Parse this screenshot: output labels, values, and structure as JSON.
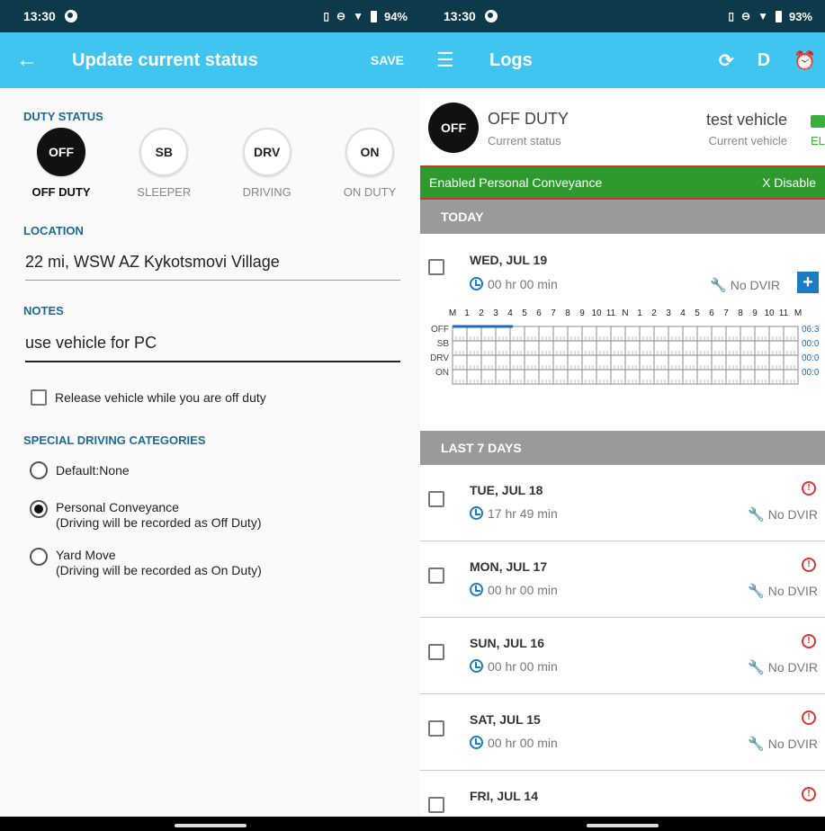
{
  "left": {
    "status_bar": {
      "time": "13:30",
      "battery": "94%"
    },
    "app_bar": {
      "title": "Update current status",
      "save": "SAVE"
    },
    "duty_status": {
      "label": "DUTY STATUS",
      "options": [
        {
          "code": "OFF",
          "label": "OFF DUTY",
          "active": true
        },
        {
          "code": "SB",
          "label": "SLEEPER",
          "active": false
        },
        {
          "code": "DRV",
          "label": "DRIVING",
          "active": false
        },
        {
          "code": "ON",
          "label": "ON DUTY",
          "active": false
        }
      ]
    },
    "location": {
      "label": "LOCATION",
      "value": "22 mi, WSW AZ Kykotsmovi Village"
    },
    "notes": {
      "label": "NOTES",
      "value": "use vehicle for PC"
    },
    "release_vehicle": {
      "label": "Release vehicle while you are off duty",
      "checked": false
    },
    "special_categories": {
      "label": "SPECIAL DRIVING CATEGORIES",
      "options": [
        {
          "label": "Default:None",
          "sublabel": "",
          "selected": false
        },
        {
          "label": "Personal Conveyance",
          "sublabel": "(Driving will be recorded as Off Duty)",
          "selected": true
        },
        {
          "label": "Yard Move",
          "sublabel": "(Driving will be recorded as On Duty)",
          "selected": false
        }
      ]
    }
  },
  "right": {
    "status_bar": {
      "time": "13:30",
      "battery": "93%"
    },
    "app_bar": {
      "title": "Logs",
      "d_label": "D"
    },
    "current": {
      "code": "OFF",
      "status": "OFF DUTY",
      "status_caption": "Current status",
      "vehicle": "test vehicle",
      "vehicle_caption": "Current vehicle",
      "eld": "ELD"
    },
    "banner": {
      "text": "Enabled Personal Conveyance",
      "action": "X Disable"
    },
    "today": {
      "header": "TODAY",
      "date": "WED, JUL 19",
      "duration": "00 hr  00 min",
      "dvir": "No DVIR",
      "plus": "+",
      "graph": {
        "hour_labels": [
          "M",
          "1",
          "2",
          "3",
          "4",
          "5",
          "6",
          "7",
          "8",
          "9",
          "10",
          "11",
          "N",
          "1",
          "2",
          "3",
          "4",
          "5",
          "6",
          "7",
          "8",
          "9",
          "10",
          "11",
          "M"
        ],
        "rows": [
          "OFF",
          "SB",
          "DRV",
          "ON"
        ],
        "totals": [
          "06:3",
          "00:0",
          "00:0",
          "00:0"
        ],
        "off_duty_segment_hours": [
          0,
          4.2
        ]
      }
    },
    "last7": {
      "header": "LAST 7 DAYS",
      "days": [
        {
          "date": "TUE, JUL 18",
          "duration": "17 hr  49 min",
          "dvir": "No DVIR",
          "alert": "!"
        },
        {
          "date": "MON, JUL 17",
          "duration": "00 hr  00 min",
          "dvir": "No DVIR",
          "alert": "!"
        },
        {
          "date": "SUN, JUL 16",
          "duration": "00 hr  00 min",
          "dvir": "No DVIR",
          "alert": "!"
        },
        {
          "date": "SAT, JUL 15",
          "duration": "00 hr  00 min",
          "dvir": "No DVIR",
          "alert": "!"
        },
        {
          "date": "FRI, JUL 14",
          "duration": "",
          "dvir": "",
          "alert": "!"
        }
      ]
    }
  },
  "colors": {
    "appbar": "#40c4f0",
    "statusbar": "#0d3a4a",
    "accent_text": "#1a6b9a",
    "banner": "#2e9a2e",
    "graph_line": "#1a6bc4"
  }
}
